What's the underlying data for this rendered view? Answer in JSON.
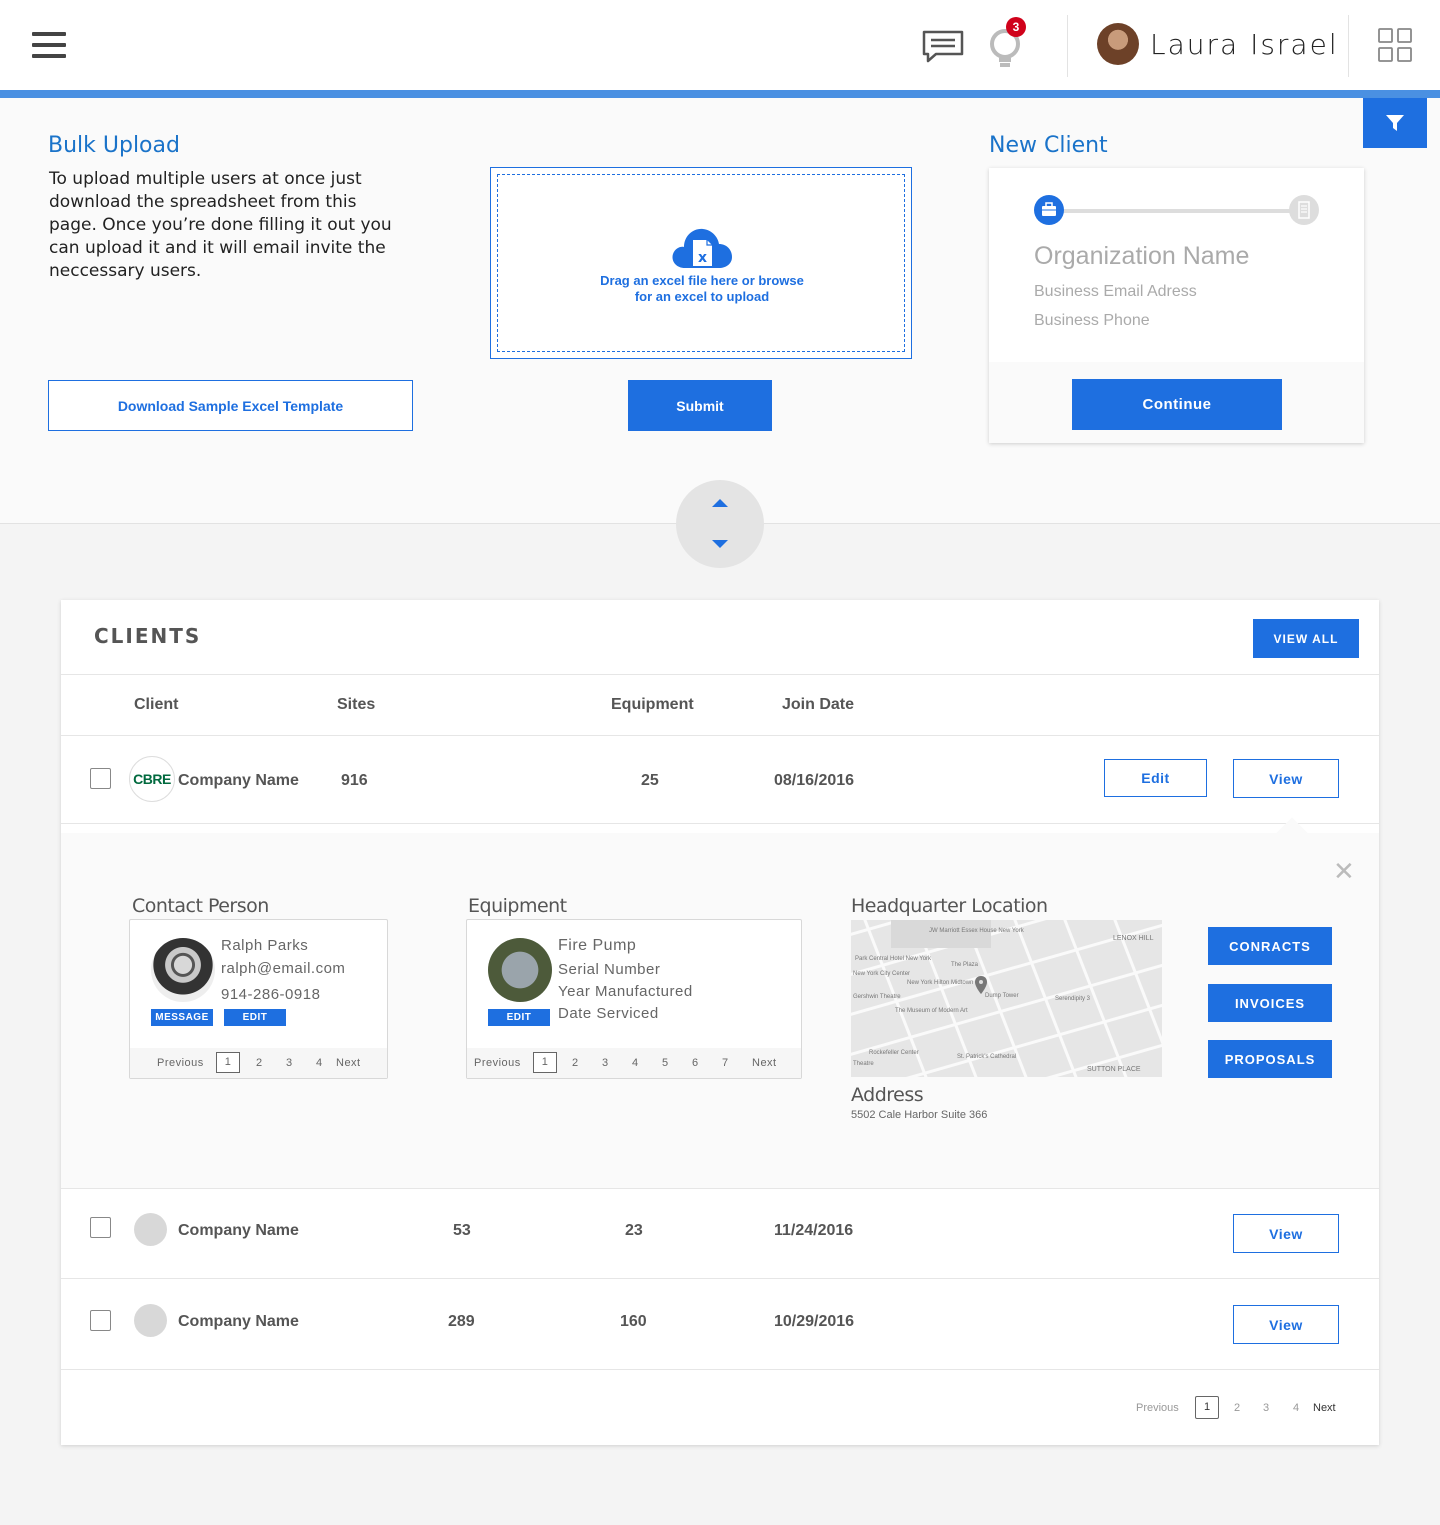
{
  "header": {
    "user_name": "Laura Israel",
    "notification_count": "3"
  },
  "bulk_upload": {
    "title": "Bulk Upload",
    "description": "To upload multiple users at once just download the spreadsheet from this page. Once you’re done filling it out you can upload it and it will email invite the neccessary users.",
    "download_label": "Download Sample Excel Template",
    "dropzone_line1": "Drag an excel file here or browse",
    "dropzone_line2": "for an excel to upload",
    "submit_label": "Submit"
  },
  "new_client": {
    "title": "New Client",
    "org_placeholder": "Organization Name",
    "email_placeholder": "Business Email Adress",
    "phone_placeholder": "Business Phone",
    "continue_label": "Continue"
  },
  "clients": {
    "title": "CLIENTS",
    "view_all_label": "VIEW ALL",
    "columns": [
      "Client",
      "Sites",
      "Equipment",
      "Join Date"
    ],
    "rows": [
      {
        "logo": "CBRE",
        "name": "Company Name",
        "sites": "916",
        "equipment": "25",
        "join_date": "08/16/2016",
        "edit_label": "Edit",
        "view_label": "View"
      },
      {
        "name": "Company Name",
        "sites": "53",
        "equipment": "23",
        "join_date": "11/24/2016",
        "view_label": "View"
      },
      {
        "name": "Company Name",
        "sites": "289",
        "equipment": "160",
        "join_date": "10/29/2016",
        "view_label": "View"
      }
    ],
    "pagination": [
      "Previous",
      "1",
      "2",
      "3",
      "4",
      "Next"
    ]
  },
  "detail": {
    "contact_title": "Contact Person",
    "contact": {
      "name": "Ralph Parks",
      "email": "ralph@email.com",
      "phone": "914-286-0918",
      "message_label": "MESSAGE",
      "edit_label": "EDIT",
      "pagination": [
        "Previous",
        "1",
        "2",
        "3",
        "4",
        "Next"
      ]
    },
    "equipment_title": "Equipment",
    "equipment": {
      "name": "Fire Pump",
      "line1": "Serial Number",
      "line2": "Year Manufactured",
      "line3": "Date Serviced",
      "edit_label": "EDIT",
      "pagination": [
        "Previous",
        "1",
        "2",
        "3",
        "4",
        "5",
        "6",
        "7",
        "Next"
      ]
    },
    "location_title": "Headquarter Location",
    "map_labels": [
      "JW Marriott Essex House New York",
      "LENOX HILL",
      "Park Central Hotel New York",
      "The Plaza",
      "New York City Center",
      "New York Hilton Midtown",
      "Dump Tower",
      "Serendipity 3",
      "Gershwin Theatre",
      "The Museum of Modern Art",
      "Rockefeller Center",
      "St. Patrick's Cathedral",
      "SUTTON PLACE",
      "Theatre"
    ],
    "address_title": "Address",
    "address": "5502 Cale Harbor Suite 366",
    "buttons": [
      "CONRACTS",
      "INVOICES",
      "PROPOSALS"
    ]
  }
}
